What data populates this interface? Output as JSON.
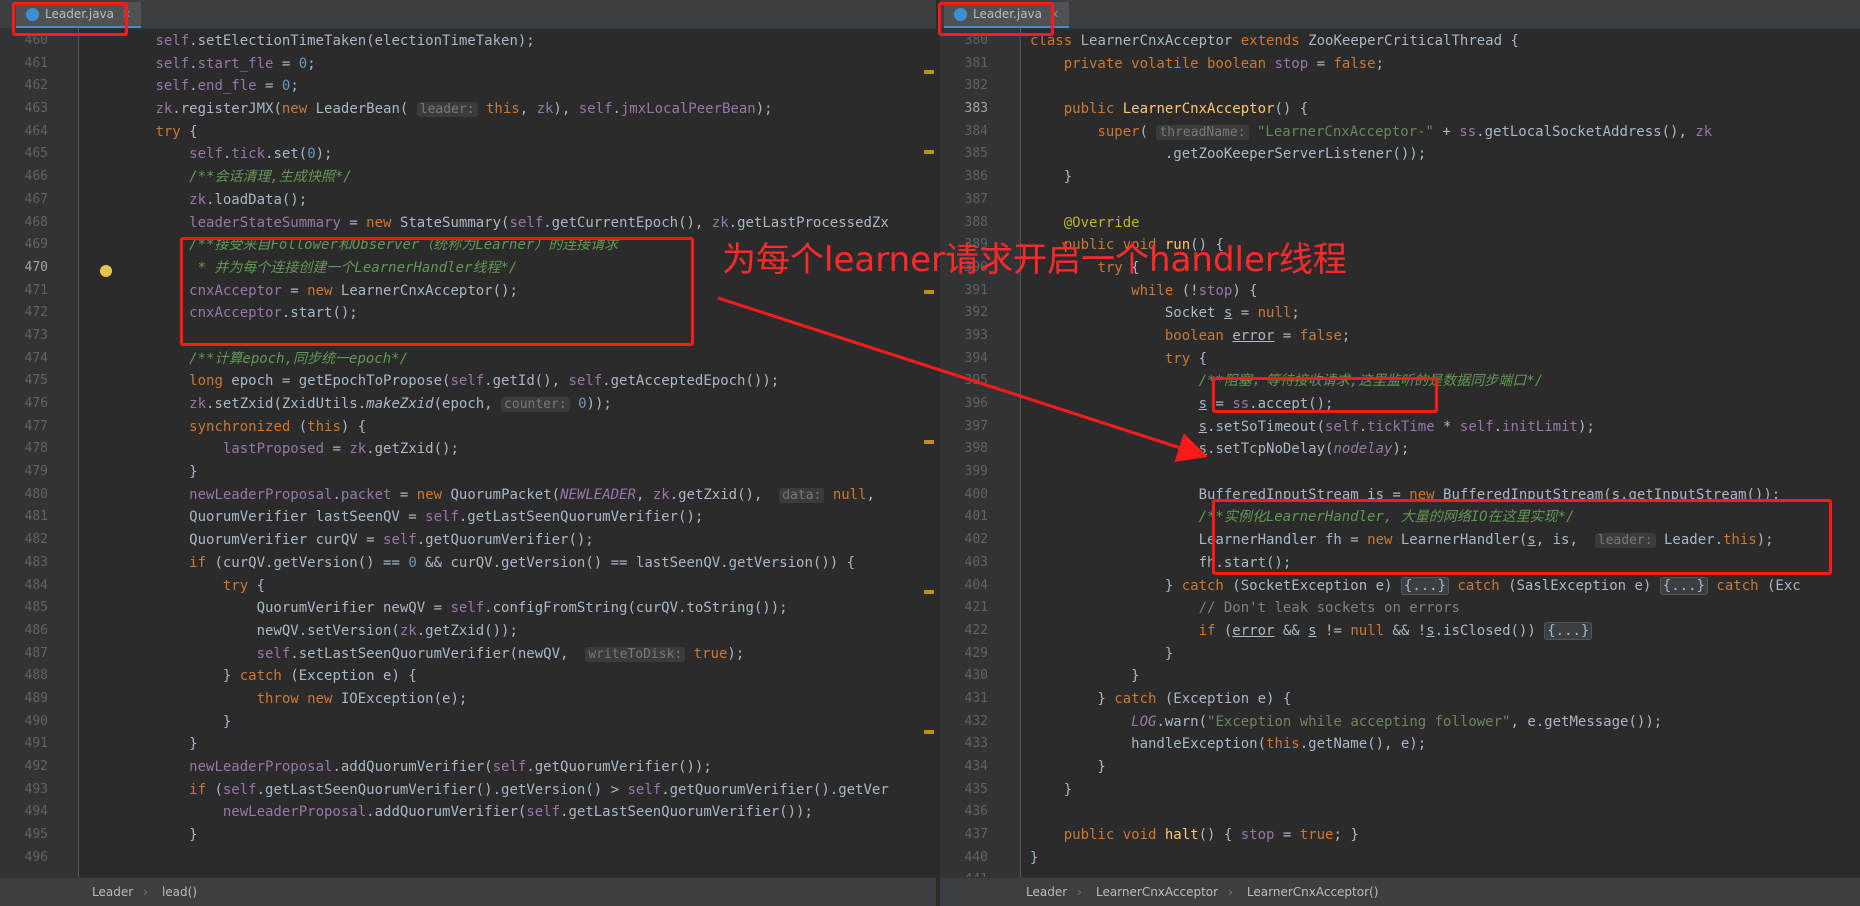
{
  "left_editor": {
    "tab": "Leader.java",
    "breadcrumbs": [
      "Leader",
      "lead()"
    ],
    "lines": [
      {
        "n": "460",
        "html": "        <span class='fld'>self</span>.setElectionTimeTaken(electionTimeTaken);"
      },
      {
        "n": "461",
        "html": "        <span class='fld'>self</span>.<span class='fld'>start_fle</span> = <span class='num'>0</span>;"
      },
      {
        "n": "462",
        "html": "        <span class='fld'>self</span>.<span class='fld'>end_fle</span> = <span class='num'>0</span>;"
      },
      {
        "n": "463",
        "html": "        <span class='fld'>zk</span>.registerJMX(<span class='kw'>new</span> LeaderBean( <span class='hint'>leader:</span> <span class='kw'>this</span>, <span class='fld'>zk</span>), <span class='fld'>self</span>.<span class='fld'>jmxLocalPeerBean</span>);"
      },
      {
        "n": "464",
        "html": "        <span class='kw'>try</span> {"
      },
      {
        "n": "465",
        "html": "            <span class='fld'>self</span>.<span class='fld'>tick</span>.set(<span class='num'>0</span>);"
      },
      {
        "n": "466",
        "html": "            <span class='cmt'>/**会话清理,生成快照*/</span>"
      },
      {
        "n": "467",
        "html": "            <span class='fld'>zk</span>.loadData();"
      },
      {
        "n": "468",
        "html": "            <span class='fld'>leaderStateSummary</span> = <span class='kw'>new</span> StateSummary(<span class='fld'>self</span>.getCurrentEpoch(), <span class='fld'>zk</span>.getLastProcessedZx"
      },
      {
        "n": "469",
        "html": "            <span class='cmt'>/**接受来自Follower和Observer（统称为Learner）的连接请求</span>"
      },
      {
        "n": "470",
        "html": "             <span class='cmt'>* 并为每个连接创建一个LearnerHandler线程*/</span>"
      },
      {
        "n": "471",
        "html": "            <span class='fld'>cnxAcceptor</span> = <span class='kw'>new</span> LearnerCnxAcceptor();"
      },
      {
        "n": "472",
        "html": "            <span class='fld'>cnxAcceptor</span>.start();"
      },
      {
        "n": "473",
        "html": ""
      },
      {
        "n": "474",
        "html": "            <span class='cmt'>/**计算epoch,同步统一epoch*/</span>"
      },
      {
        "n": "475",
        "html": "            <span class='kw'>long</span> epoch = getEpochToPropose(<span class='fld'>self</span>.getId(), <span class='fld'>self</span>.getAcceptedEpoch());"
      },
      {
        "n": "476",
        "html": "            <span class='fld'>zk</span>.setZxid(ZxidUtils.<span class='itl'>makeZxid</span>(epoch, <span class='hint'>counter:</span> <span class='num'>0</span>));"
      },
      {
        "n": "477",
        "html": "            <span class='kw'>synchronized</span> (<span class='kw'>this</span>) {"
      },
      {
        "n": "478",
        "html": "                <span class='fld'>lastProposed</span> = <span class='fld'>zk</span>.getZxid();"
      },
      {
        "n": "479",
        "html": "            }"
      },
      {
        "n": "480",
        "html": "            <span class='fld'>newLeaderProposal</span>.<span class='fld'>packet</span> = <span class='kw'>new</span> QuorumPacket(<span class='fld itl'>NEWLEADER</span>, <span class='fld'>zk</span>.getZxid(),  <span class='hint'>data:</span> <span class='kw'>null</span>,"
      },
      {
        "n": "481",
        "html": "            QuorumVerifier lastSeenQV = <span class='fld'>self</span>.getLastSeenQuorumVerifier();"
      },
      {
        "n": "482",
        "html": "            QuorumVerifier curQV = <span class='fld'>self</span>.getQuorumVerifier();"
      },
      {
        "n": "483",
        "html": "            <span class='kw'>if</span> (curQV.getVersion() == <span class='num'>0</span> &amp;&amp; curQV.getVersion() == lastSeenQV.getVersion()) {"
      },
      {
        "n": "484",
        "html": "                <span class='kw'>try</span> {"
      },
      {
        "n": "485",
        "html": "                    QuorumVerifier newQV = <span class='fld'>self</span>.configFromString(curQV.toString());"
      },
      {
        "n": "486",
        "html": "                    newQV.setVersion(<span class='fld'>zk</span>.getZxid());"
      },
      {
        "n": "487",
        "html": "                    <span class='fld'>self</span>.setLastSeenQuorumVerifier(newQV,  <span class='hint'>writeToDisk:</span> <span class='kw'>true</span>);"
      },
      {
        "n": "488",
        "html": "                } <span class='kw'>catch</span> (Exception e) {"
      },
      {
        "n": "489",
        "html": "                    <span class='kw'>throw new</span> IOException(e);"
      },
      {
        "n": "490",
        "html": "                }"
      },
      {
        "n": "491",
        "html": "            }"
      },
      {
        "n": "492",
        "html": "            <span class='fld'>newLeaderProposal</span>.addQuorumVerifier(<span class='fld'>self</span>.getQuorumVerifier());"
      },
      {
        "n": "493",
        "html": "            <span class='kw'>if</span> (<span class='fld'>self</span>.getLastSeenQuorumVerifier().getVersion() &gt; <span class='fld'>self</span>.getQuorumVerifier().getVer"
      },
      {
        "n": "494",
        "html": "                <span class='fld'>newLeaderProposal</span>.addQuorumVerifier(<span class='fld'>self</span>.getLastSeenQuorumVerifier());"
      },
      {
        "n": "495",
        "html": "            }"
      },
      {
        "n": "496",
        "html": ""
      }
    ]
  },
  "right_editor": {
    "tab": "Leader.java",
    "breadcrumbs": [
      "Leader",
      "LearnerCnxAcceptor",
      "LearnerCnxAcceptor()"
    ],
    "lines": [
      {
        "n": "380",
        "html": "<span class='kw'>class</span> LearnerCnxAcceptor <span class='kw'>extends</span> ZooKeeperCriticalThread {"
      },
      {
        "n": "381",
        "html": "    <span class='kw'>private volatile boolean</span> <span class='fld'>stop</span> = <span class='kw'>false</span>;"
      },
      {
        "n": "382",
        "html": ""
      },
      {
        "n": "383",
        "html": "    <span class='kw'>public</span> <span class='fn'>LearnerCnxAcceptor</span>() {"
      },
      {
        "n": "384",
        "html": "        <span class='kw'>super</span>( <span class='hint'>threadName:</span> <span class='str'>\"LearnerCnxAcceptor-\"</span> + <span class='fld'>ss</span>.getLocalSocketAddress(), <span class='fld'>zk</span>"
      },
      {
        "n": "385",
        "html": "                .getZooKeeperServerListener());"
      },
      {
        "n": "386",
        "html": "    }"
      },
      {
        "n": "387",
        "html": ""
      },
      {
        "n": "388",
        "html": "    <span class='ann'>@Override</span>"
      },
      {
        "n": "389",
        "html": "    <span class='kw'>public void</span> <span class='fn'>run</span>() {"
      },
      {
        "n": "390",
        "html": "        <span class='kw'>try</span> {"
      },
      {
        "n": "391",
        "html": "            <span class='kw'>while</span> (!<span class='fld'>stop</span>) {"
      },
      {
        "n": "392",
        "html": "                Socket <span class='uline'>s</span> = <span class='kw'>null</span>;"
      },
      {
        "n": "393",
        "html": "                <span class='kw'>boolean</span> <span class='uline'>error</span> = <span class='kw'>false</span>;"
      },
      {
        "n": "394",
        "html": "                <span class='kw'>try</span> {"
      },
      {
        "n": "395",
        "html": "                    <span class='cmt'>/**阻塞，等待接收请求,这里监听的是数据同步端口*/</span>"
      },
      {
        "n": "396",
        "html": "                    <span class='uline'>s</span> = <span class='fld'>ss</span>.accept();"
      },
      {
        "n": "397",
        "html": "                    <span class='uline'>s</span>.setSoTimeout(<span class='fld'>self</span>.<span class='fld'>tickTime</span> * <span class='fld'>self</span>.<span class='fld'>initLimit</span>);"
      },
      {
        "n": "398",
        "html": "                    <span class='uline'>s</span>.setTcpNoDelay(<span class='fld itl'>nodelay</span>);"
      },
      {
        "n": "399",
        "html": ""
      },
      {
        "n": "400",
        "html": "                    BufferedInputStream is = <span class='kw'>new</span> BufferedInputStream(<span class='uline'>s</span>.getInputStream());"
      },
      {
        "n": "401",
        "html": "                    <span class='cmt'>/**实例化LearnerHandler, 大量的网络IO在这里实现*/</span>"
      },
      {
        "n": "402",
        "html": "                    LearnerHandler fh = <span class='kw'>new</span> LearnerHandler(<span class='uline'>s</span>, is,  <span class='hint'>leader:</span> Leader.<span class='kw'>this</span>);"
      },
      {
        "n": "403",
        "html": "                    fh.start();"
      },
      {
        "n": "404",
        "html": "                } <span class='kw'>catch</span> (SocketException e) <span class='fold'>{...}</span> <span class='kw'>catch</span> (SaslException e) <span class='fold'>{...}</span> <span class='kw'>catch</span> (Exc"
      },
      {
        "n": "421",
        "html": "                    <span class='cmt-plain'>// Don't leak sockets on errors</span>"
      },
      {
        "n": "422",
        "html": "                    <span class='kw'>if</span> (<span class='uline'>error</span> &amp;&amp; <span class='uline'>s</span> != <span class='kw'>null</span> &amp;&amp; !<span class='uline'>s</span>.isClosed()) <span class='fold'>{...}</span>"
      },
      {
        "n": "429",
        "html": "                }"
      },
      {
        "n": "430",
        "html": "            }"
      },
      {
        "n": "431",
        "html": "        } <span class='kw'>catch</span> (Exception e) {"
      },
      {
        "n": "432",
        "html": "            <span class='fld itl'>LOG</span>.warn(<span class='str'>\"Exception while accepting follower\"</span>, e.getMessage());"
      },
      {
        "n": "433",
        "html": "            handleException(<span class='kw'>this</span>.getName(), e);"
      },
      {
        "n": "434",
        "html": "        }"
      },
      {
        "n": "435",
        "html": "    }"
      },
      {
        "n": "436",
        "html": ""
      },
      {
        "n": "437",
        "html": "    <span class='kw'>public void</span> <span class='fn'>halt</span>() { <span class='fld'>stop</span> = <span class='kw'>true</span>; }"
      },
      {
        "n": "440",
        "html": "}"
      },
      {
        "n": "441",
        "html": ""
      }
    ]
  },
  "annotation": {
    "callout_text": "为每个learner请求开启一个handler线程",
    "highlight_color": "#ff1a1a"
  },
  "icons": {
    "file_icon": "java-class-icon",
    "close_icon": "close-icon",
    "bulb_icon": "intention-bulb-icon"
  }
}
